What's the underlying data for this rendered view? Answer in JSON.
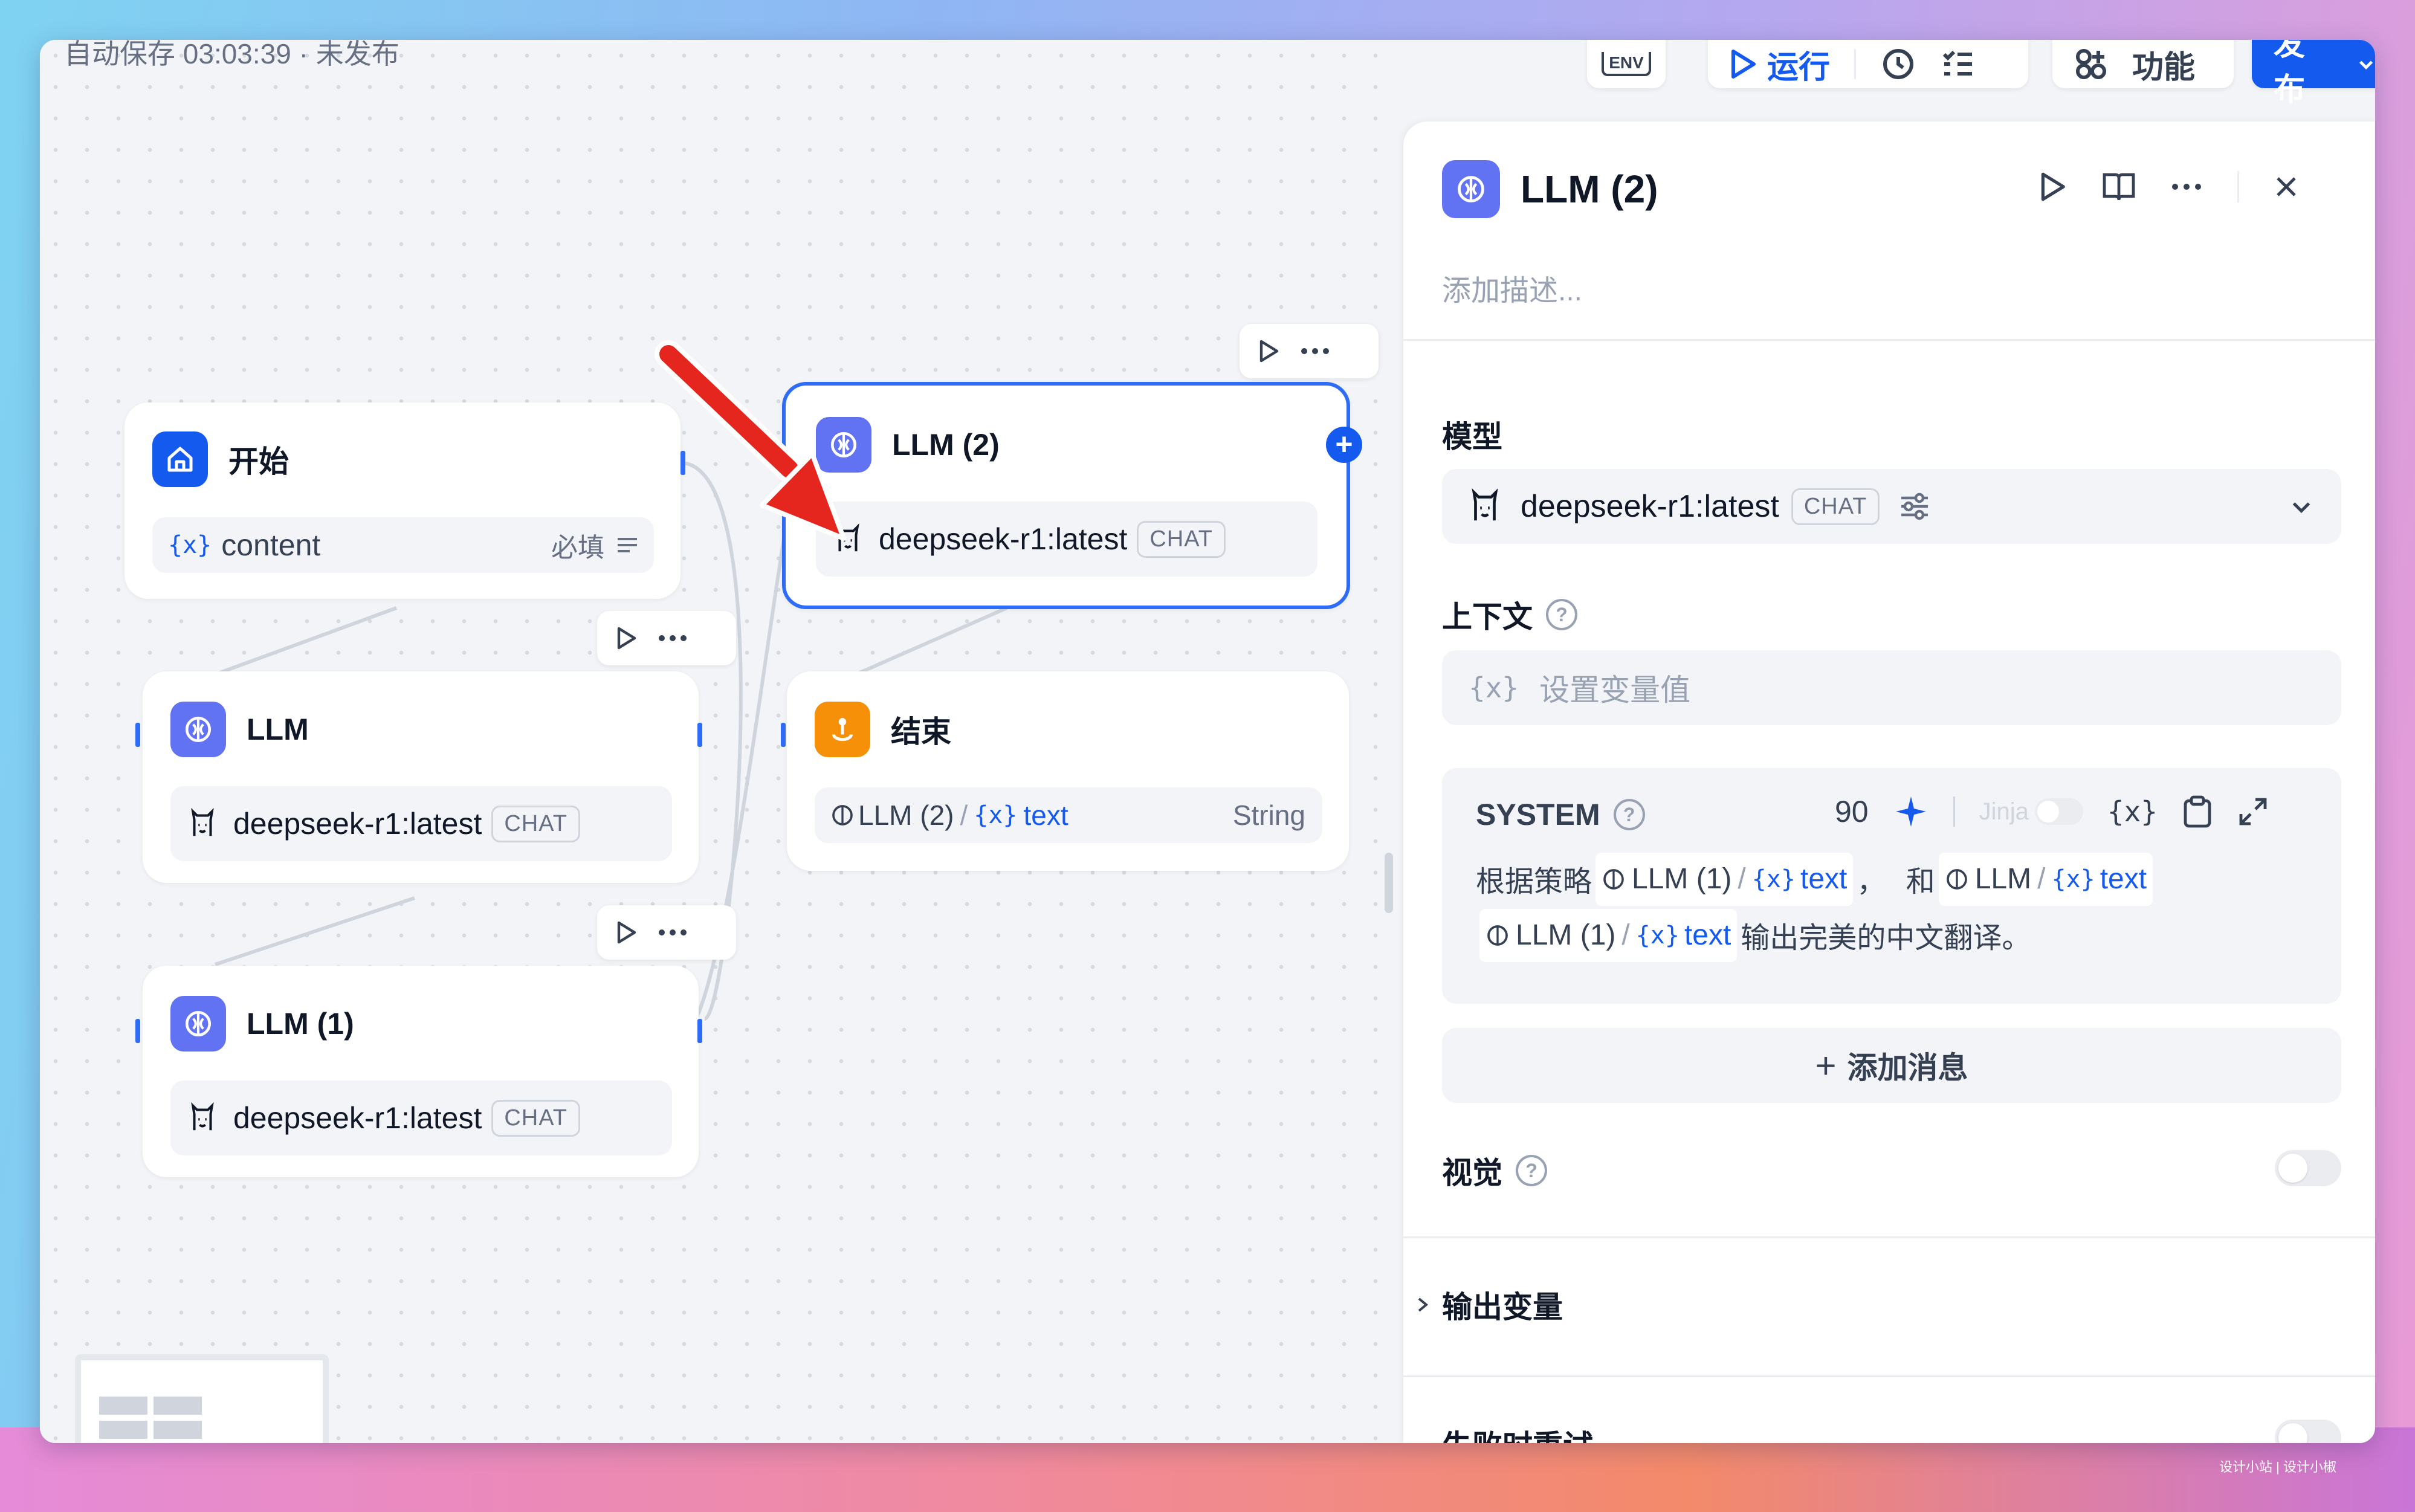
{
  "topbar": {
    "autosave": "自动保存 03:03:39 · 未发布",
    "env_label": "ENV",
    "run_label": "运行",
    "features_label": "功能",
    "publish_label": "发布"
  },
  "nodes": {
    "start": {
      "title": "开始",
      "var_name": "content",
      "required": "必填"
    },
    "llm": {
      "title": "LLM",
      "model": "deepseek-r1:latest",
      "badge": "CHAT"
    },
    "llm1": {
      "title": "LLM (1)",
      "model": "deepseek-r1:latest",
      "badge": "CHAT"
    },
    "llm2": {
      "title": "LLM (2)",
      "model": "deepseek-r1:latest",
      "badge": "CHAT"
    },
    "end": {
      "title": "结束",
      "ref_node": "LLM (2)",
      "ref_var": "text",
      "type": "String"
    }
  },
  "panel": {
    "title": "LLM (2)",
    "description_placeholder": "添加描述...",
    "model_section": "模型",
    "model_name": "deepseek-r1:latest",
    "model_badge": "CHAT",
    "context_section": "上下文",
    "context_placeholder": "设置变量值",
    "system_label": "SYSTEM",
    "token_count": "90",
    "jinja_label": "Jinja",
    "prompt": {
      "part1": "根据策略",
      "ref1_node": "LLM (1)",
      "ref1_var": "text",
      "sep": "，",
      "part2": "和",
      "ref2_node": "LLM",
      "ref2_var": "text",
      "ref3_node": "LLM (1)",
      "ref3_var": "text",
      "part3": "输出完美的中文翻译。"
    },
    "add_message": "添加消息",
    "vision_section": "视觉",
    "output_section": "输出变量",
    "retry_section": "失败时重试"
  },
  "footer": {
    "watermark": "设计小站 | 设计小椒"
  },
  "colors": {
    "accent": "#155aef",
    "arrow": "#e5261f",
    "llm_icon": "#6172f3",
    "end_icon": "#f79009"
  }
}
